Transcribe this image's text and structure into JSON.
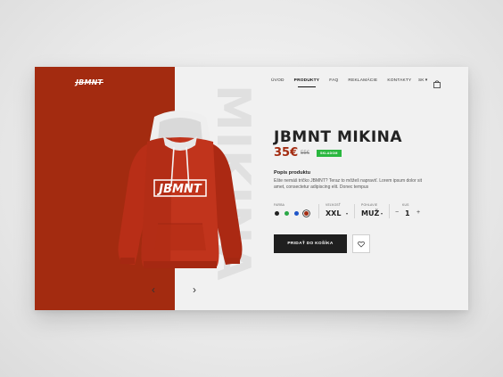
{
  "brand": {
    "logo_text": "JBMNT"
  },
  "nav": {
    "items": [
      {
        "label": "ÚVOD",
        "active": false
      },
      {
        "label": "PRODUKTY",
        "active": true
      },
      {
        "label": "FAQ",
        "active": false
      },
      {
        "label": "REKLAMÁCIE",
        "active": false
      },
      {
        "label": "KONTAKTY",
        "active": false
      }
    ],
    "lang": "SK ▾",
    "cart_icon": "bag-icon"
  },
  "product": {
    "watermark": "MIKINA",
    "title": "JBMNT MIKINA",
    "price": "35€",
    "old_price": "55€",
    "badge": "SKLADOM",
    "hoodie_print": "JBMNT",
    "description_title": "Popis produktu",
    "description": "Ešte nemáš tričko JBMNT? Teraz to môžeš napraviť. Lorem ipsum dolor sit amet, consectetur adipiscing elit. Donec tempus",
    "colors": {
      "label": "FARBA",
      "swatches": [
        "#222222",
        "#2aa846",
        "#1f55c9",
        "#a32b10"
      ],
      "selected_index": 3
    },
    "size": {
      "label": "VEĽKOSŤ",
      "value": "XXL"
    },
    "gender": {
      "label": "POHLAVIE",
      "value": "MUŽ"
    },
    "quantity": {
      "label": "KUS",
      "value": "1",
      "minus": "−",
      "plus": "+"
    },
    "add_to_cart": "PRIDAŤ DO KOŠÍKA",
    "favorite_icon": "heart-icon"
  },
  "carousel": {
    "prev": "‹",
    "next": "›"
  },
  "colors": {
    "accent": "#a32b10",
    "dark": "#1f1f1f",
    "stock_green": "#2ab73f"
  }
}
